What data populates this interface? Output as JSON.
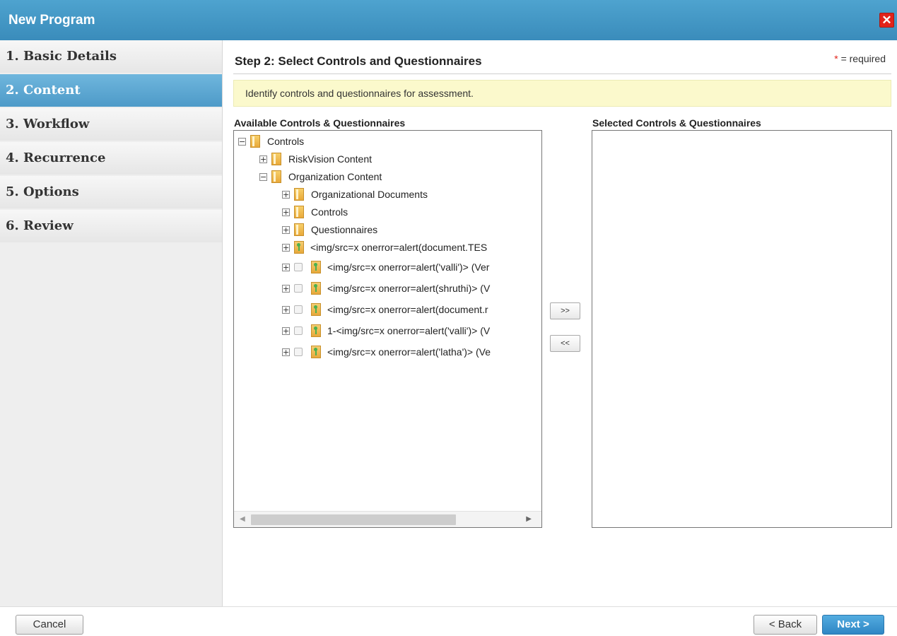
{
  "dialog": {
    "title": "New Program",
    "close_glyph": "✕"
  },
  "sidebar": {
    "items": [
      {
        "label": "1. Basic Details",
        "active": false
      },
      {
        "label": "2. Content",
        "active": true
      },
      {
        "label": "3. Workflow",
        "active": false
      },
      {
        "label": "4. Recurrence",
        "active": false
      },
      {
        "label": "5. Options",
        "active": false
      },
      {
        "label": "6. Review",
        "active": false
      }
    ]
  },
  "main": {
    "step_title": "Step 2: Select Controls and Questionnaires",
    "required_mark": "*",
    "required_text": "= required",
    "info": "Identify controls and questionnaires for assessment."
  },
  "available": {
    "label": "Available Controls & Questionnaires",
    "tree": [
      {
        "toggle": "−",
        "icon": "folder-icon",
        "label": "Controls"
      },
      {
        "toggle": "+",
        "icon": "folder-icon",
        "label": "RiskVision Content"
      },
      {
        "toggle": "−",
        "icon": "folder-icon",
        "label": "Organization Content"
      },
      {
        "toggle": "+",
        "icon": "folder-icon",
        "label": "Organizational Documents"
      },
      {
        "toggle": "+",
        "icon": "folder-icon",
        "label": "Controls"
      },
      {
        "toggle": "+",
        "icon": "folder-icon",
        "label": "Questionnaires"
      },
      {
        "toggle": "+",
        "icon": "control-item-icon",
        "label": "<img/src=x onerror=alert(document.TES"
      },
      {
        "toggle": "+",
        "checkbox": true,
        "icon": "control-item-icon",
        "label": "<img/src=x onerror=alert('valli')> (Ver"
      },
      {
        "toggle": "+",
        "checkbox": true,
        "icon": "control-item-icon",
        "label": "<img/src=x onerror=alert(shruthi)> (V"
      },
      {
        "toggle": "+",
        "checkbox": true,
        "icon": "control-item-icon",
        "label": "<img/src=x onerror=alert(document.r"
      },
      {
        "toggle": "+",
        "checkbox": true,
        "icon": "control-item-icon",
        "label": "1-<img/src=x onerror=alert('valli')> (V"
      },
      {
        "toggle": "+",
        "checkbox": true,
        "icon": "control-item-icon",
        "label": "<img/src=x onerror=alert('latha')> (Ve"
      }
    ]
  },
  "selected": {
    "label": "Selected Controls & Questionnaires"
  },
  "move_buttons": {
    "add": ">>",
    "remove": "<<"
  },
  "footer": {
    "cancel": "Cancel",
    "back": "< Back",
    "next": "Next >"
  },
  "colors": {
    "title_bar": "#3a8cbb",
    "accent": "#2e86c4",
    "info_background": "#fbf9cc",
    "close": "#e2231a"
  }
}
